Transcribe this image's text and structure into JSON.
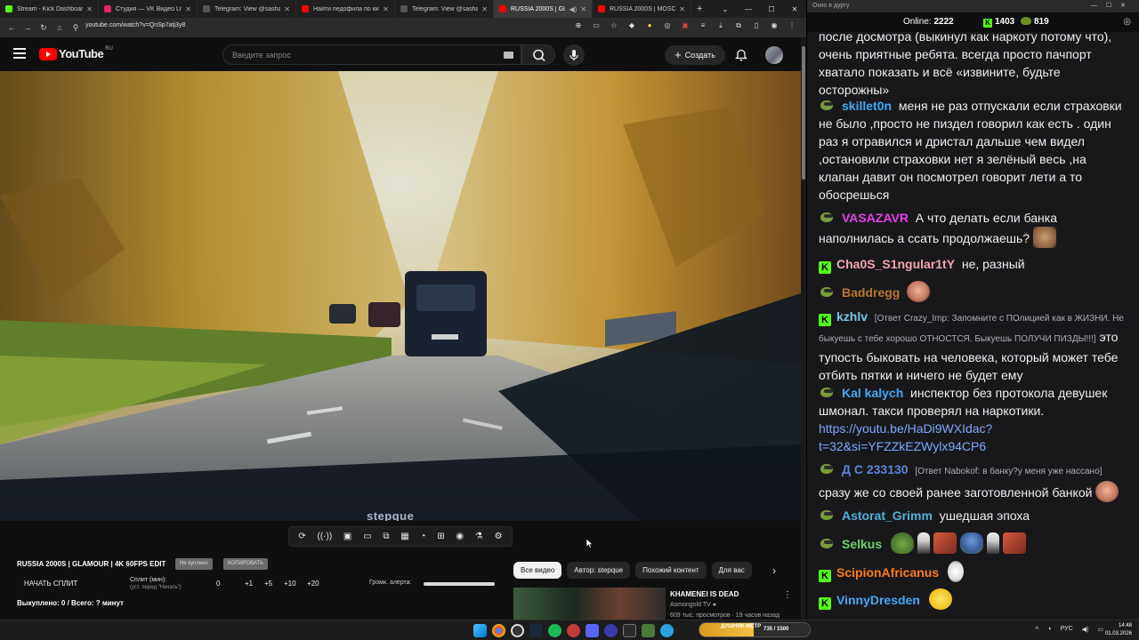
{
  "browser": {
    "tabs": [
      {
        "title": "Stream - Kick Dashboard",
        "favicon_color": "#53fc18",
        "active": false
      },
      {
        "title": "Студия — VK Видео Live",
        "favicon_color": "#e0245e",
        "active": false
      },
      {
        "title": "Telegram: View @sashakon",
        "favicon_color": "#3a3a3a",
        "active": false
      },
      {
        "title": "Найти педофила по кирпи",
        "favicon_color": "#ff0000",
        "active": false
      },
      {
        "title": "Telegram: View @sashakon",
        "favicon_color": "#3a3a3a",
        "active": false
      },
      {
        "title": "RUSSIA 2000S | GLAMOU",
        "favicon_color": "#ff0000",
        "active": true
      },
      {
        "title": "RUSSIA 2000S | MOSCOW f",
        "favicon_color": "#ff0000",
        "active": false
      }
    ],
    "new_tab": "+",
    "window_controls": {
      "tabs_menu": "⌄",
      "minimize": "—",
      "maximize": "☐",
      "close": "✕"
    },
    "url": "youtube.com/watch?v=QnSp7atj3y8"
  },
  "youtube": {
    "logo_text": "YouTube",
    "region": "RU",
    "search_placeholder": "Введите запрос",
    "create_label": "Создать",
    "video": {
      "watermark": "stepque"
    },
    "extension_toolbar": [
      "⟳",
      "((·))",
      "▣",
      "▭",
      "⧉",
      "▦",
      "◔",
      "⊞",
      "◉",
      "⚗",
      "⚙"
    ],
    "below": {
      "title": "RUSSIA 2000S | GLAMOUR | 4K 60FPS EDIT",
      "chip_not_bought": "Не куплено",
      "chip_copy": "КОПИРОВАТЬ",
      "split_button": "НАЧАТЬ СПЛИТ",
      "split_label": "Сплит (мин):",
      "split_sub": "(уст. перед \"Начать\")",
      "split_values": [
        "0",
        "+1",
        "+5",
        "+10",
        "+20"
      ],
      "alert_volume_label": "Громк. алерта:",
      "alert_volume": 1.0,
      "paid_text": "Выкуплено: 0 / Всего: ? минут"
    },
    "chips": [
      "Все видео",
      "Автор: stepque",
      "Похожий контент",
      "Для вас"
    ],
    "recommendation": {
      "title": "KHAMENEI IS DEAD",
      "channel": "Asmongold TV",
      "meta": "609 тыс. просмотров · 19 часов назад"
    }
  },
  "chat": {
    "window_title": "Окно в дургу",
    "online_label": "Online:",
    "online_count": "2222",
    "kick_count": "1403",
    "other_count": "819",
    "messages": [
      {
        "id": "m0",
        "user": "",
        "user_color": "",
        "badge": "",
        "reply": "",
        "text": "после досмотра (выкинул как наркоту потому что), очень приятные ребята. всегда просто пачпорт хватало показать и всё «извините, будьте осторожны»",
        "link": ""
      },
      {
        "id": "m1",
        "user": "skillet0n",
        "user_color": "#3fa9f5",
        "badge": "pepe",
        "reply": "",
        "text": "меня не раз отпускали если страховки не было ,просто не пиздел говорил как есть . один раз я отравился и дристал дальше чем видел ,остановили страховки нет я зелёный весь ,на клапан давит он посмотрел говорит лети а то обосрешься",
        "link": ""
      },
      {
        "id": "m2",
        "user": "VASAZAVR",
        "user_color": "#e83ee8",
        "badge": "pepe",
        "reply": "",
        "text": "А что делать если банка наполнилась а ссать продолжаешь?",
        "link": ""
      },
      {
        "id": "m3",
        "user": "Cha0S_S1ngular1tY",
        "user_color": "#f3a6b0",
        "badge": "kick",
        "reply": "",
        "text": "не, разный",
        "link": ""
      },
      {
        "id": "m4",
        "user": "Baddregg",
        "user_color": "#b9772d",
        "badge": "pepe",
        "reply": "",
        "text": "",
        "link": ""
      },
      {
        "id": "m5",
        "user": "kzhlv",
        "user_color": "#79c6e8",
        "badge": "kick",
        "reply": "[Ответ Crazy_Imp: Запомните с ПОлицией как в ЖИЗНИ. Не быкуешь с тебе хорошо ОТНОСТСЯ. Быкуешь ПОЛУЧИ ПИЗДЫ!!!]",
        "text": "это тупость быковать на человека, который может тебе отбить пятки и ничего не будет ему",
        "link": ""
      },
      {
        "id": "m6",
        "user": "Kal kalych",
        "user_color": "#3fa9f5",
        "badge": "pepe",
        "reply": "",
        "text": "инспектор без протокола девушек шмонал. такси проверял на наркотики.",
        "link": "https://youtu.be/HaDi9WXIdac?t=32&si=YFZZkEZWylx94CP6"
      },
      {
        "id": "m7",
        "user": "Д С 233130",
        "user_color": "#5b86d6",
        "badge": "pepe",
        "reply": "[Ответ Nabokof: в банку?у меня уже нассано]",
        "text": "сразу же со своей ранее заготовленной банкой",
        "link": ""
      },
      {
        "id": "m8",
        "user": "Astorat_Grimm",
        "user_color": "#4fb3d9",
        "badge": "pepe",
        "reply": "",
        "text": "ушедшая эпоха",
        "link": ""
      },
      {
        "id": "m9",
        "user": "Selkus",
        "user_color": "#6ad36a",
        "badge": "pepe",
        "reply": "",
        "text": "",
        "link": ""
      },
      {
        "id": "m10",
        "user": "ScipionAfricanus",
        "user_color": "#ff7c1a",
        "badge": "kick",
        "reply": "",
        "text": "",
        "link": ""
      },
      {
        "id": "m11",
        "user": "VinnyDresden",
        "user_color": "#3fa9f5",
        "badge": "kick",
        "reply": "",
        "text": "",
        "link": ""
      }
    ]
  },
  "taskbar": {
    "widget_label": "ДУШНЯК-МЕТР",
    "widget_count": "735 / 1500",
    "widget_progress": 0.49,
    "lang": "РУС",
    "time": "14:48",
    "date": "01.03.2026"
  }
}
